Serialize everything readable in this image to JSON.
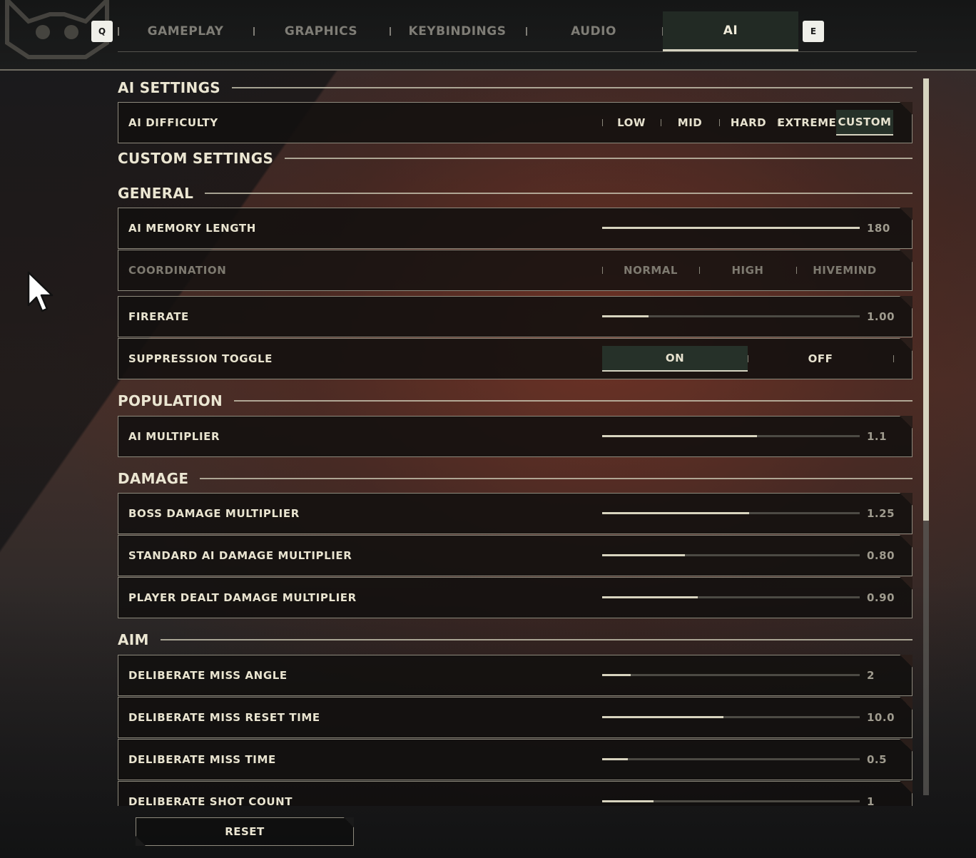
{
  "nav": {
    "prev_key": "Q",
    "next_key": "E",
    "tabs": [
      {
        "label": "GAMEPLAY",
        "active": false
      },
      {
        "label": "GRAPHICS",
        "active": false
      },
      {
        "label": "KEYBINDINGS",
        "active": false
      },
      {
        "label": "AUDIO",
        "active": false
      },
      {
        "label": "AI",
        "active": true
      }
    ]
  },
  "sections": {
    "ai_settings": "AI SETTINGS",
    "custom_settings": "CUSTOM SETTINGS",
    "general": "GENERAL",
    "population": "POPULATION",
    "damage": "DAMAGE",
    "aim": "AIM"
  },
  "ai_difficulty": {
    "label": "AI DIFFICULTY",
    "options": [
      "LOW",
      "MID",
      "HARD",
      "EXTREME",
      "CUSTOM"
    ],
    "selected": "CUSTOM"
  },
  "memory_length": {
    "label": "AI MEMORY LENGTH",
    "value": "180",
    "fill": 1.0
  },
  "coordination": {
    "label": "COORDINATION",
    "options": [
      "NORMAL",
      "HIGH",
      "HIVEMIND"
    ],
    "disabled": true
  },
  "firerate": {
    "label": "FIRERATE",
    "value": "1.00",
    "fill": 0.18
  },
  "suppression": {
    "label": "SUPPRESSION TOGGLE",
    "options": [
      "ON",
      "OFF"
    ],
    "selected": "ON"
  },
  "ai_multiplier": {
    "label": "AI MULTIPLIER",
    "value": "1.1",
    "fill": 0.6
  },
  "boss_damage": {
    "label": "BOSS DAMAGE MULTIPLIER",
    "value": "1.25",
    "fill": 0.57
  },
  "standard_damage": {
    "label": "STANDARD AI DAMAGE MULTIPLIER",
    "value": "0.80",
    "fill": 0.32
  },
  "player_damage": {
    "label": "PLAYER DEALT DAMAGE MULTIPLIER",
    "value": "0.90",
    "fill": 0.37
  },
  "miss_angle": {
    "label": "DELIBERATE MISS ANGLE",
    "value": "2",
    "fill": 0.11
  },
  "miss_reset_time": {
    "label": "DELIBERATE MISS RESET TIME",
    "value": "10.0",
    "fill": 0.47
  },
  "miss_time": {
    "label": "DELIBERATE MISS TIME",
    "value": "0.5",
    "fill": 0.1
  },
  "shot_count": {
    "label": "DELIBERATE SHOT COUNT",
    "value": "1",
    "fill": 0.2
  },
  "reset_label": "RESET",
  "colors": {
    "accent": "#d6d3c1",
    "selected_bg": "#263129",
    "panel_bg": "#121010"
  }
}
